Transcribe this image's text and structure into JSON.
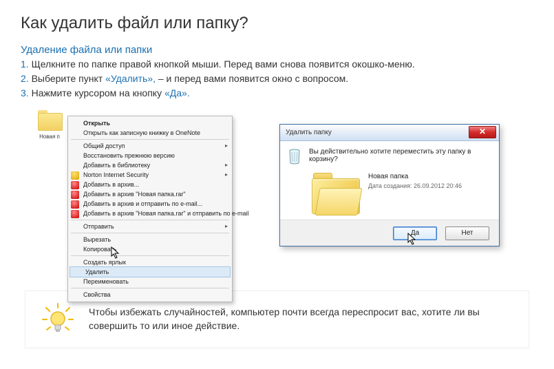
{
  "title": "Как удалить файл или папку?",
  "subtitle": "Удаление файла или папки",
  "steps": [
    {
      "num": "1.",
      "text_before": "Щелкните по папке правой кнопкой мыши. Перед вами снова появится окошко-меню.",
      "link": "",
      "text_after": ""
    },
    {
      "num": "2.",
      "text_before": "Выберите пункт ",
      "link": "«Удалить»,",
      "text_after": " – и перед вами появится окно с вопросом."
    },
    {
      "num": "3.",
      "text_before": "Нажмите курсором на кнопку ",
      "link": "«Да».",
      "text_after": ""
    }
  ],
  "folder_label": "Новая п",
  "context_menu": {
    "open": "Открыть",
    "onenote": "Открыть как записную книжку в OneNote",
    "share": "Общий доступ",
    "restore": "Восстановить прежнюю версию",
    "library": "Добавить в библиотеку",
    "norton": "Norton Internet Security",
    "archive": "Добавить в архив...",
    "archive_named": "Добавить в архив \"Новая папка.rar\"",
    "archive_email": "Добавить в архив и отправить по e-mail...",
    "archive_named_email": "Добавить в архив \"Новая папка.rar\" и отправить по e-mail",
    "send_to": "Отправить",
    "cut": "Вырезать",
    "copy": "Копировать",
    "shortcut": "Создать ярлык",
    "delete": "Удалить",
    "rename": "Переименовать",
    "properties": "Свойства"
  },
  "dialog": {
    "title": "Удалить папку",
    "question": "Вы действительно хотите переместить эту папку в корзину?",
    "folder_name": "Новая папка",
    "created": "Дата создания: 26.09.2012 20:46",
    "yes": "Да",
    "no": "Нет"
  },
  "tip": "Чтобы избежать случайностей, компьютер почти всегда переспросит вас, хотите ли вы совершить то или иное действие."
}
